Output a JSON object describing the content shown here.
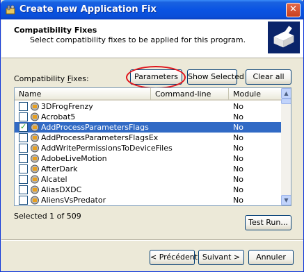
{
  "window": {
    "title": "Create new Application Fix",
    "close_glyph": "✕"
  },
  "header": {
    "title": "Compatibility Fixes",
    "subtitle": "Select compatibility fixes to be applied for this program."
  },
  "fixes_label_pre": "Compatibility ",
  "fixes_label_u": "F",
  "fixes_label_post": "ixes:",
  "buttons": {
    "parameters": "Parameters",
    "show_selected": "Show Selected",
    "clear_all": "Clear all",
    "test_run": "Test Run...",
    "back": "< Précédent",
    "next": "Suivant >",
    "cancel": "Annuler"
  },
  "columns": [
    "Name",
    "Command-line",
    "Module"
  ],
  "rows": [
    {
      "name": "3DFrogFrenzy",
      "module": "No",
      "checked": false,
      "selected": false
    },
    {
      "name": "Acrobat5",
      "module": "No",
      "checked": false,
      "selected": false
    },
    {
      "name": "AddProcessParametersFlags",
      "module": "No",
      "checked": true,
      "selected": true
    },
    {
      "name": "AddProcessParametersFlagsEx",
      "module": "No",
      "checked": false,
      "selected": false
    },
    {
      "name": "AddWritePermissionsToDeviceFiles",
      "module": "No",
      "checked": false,
      "selected": false
    },
    {
      "name": "AdobeLiveMotion",
      "module": "No",
      "checked": false,
      "selected": false
    },
    {
      "name": "AfterDark",
      "module": "No",
      "checked": false,
      "selected": false
    },
    {
      "name": "Alcatel",
      "module": "No",
      "checked": false,
      "selected": false
    },
    {
      "name": "AliasDXDC",
      "module": "No",
      "checked": false,
      "selected": false
    },
    {
      "name": "AliensVsPredator",
      "module": "No",
      "checked": false,
      "selected": false
    }
  ],
  "status": "Selected 1 of 509",
  "icons": {
    "title": "wrench-app-icon",
    "header": "wizard-box-icon",
    "row": "shim-gear-icon"
  },
  "colors": {
    "titlebar": "#0a54e3",
    "selection": "#316ac5",
    "highlight": "#e0141b"
  }
}
